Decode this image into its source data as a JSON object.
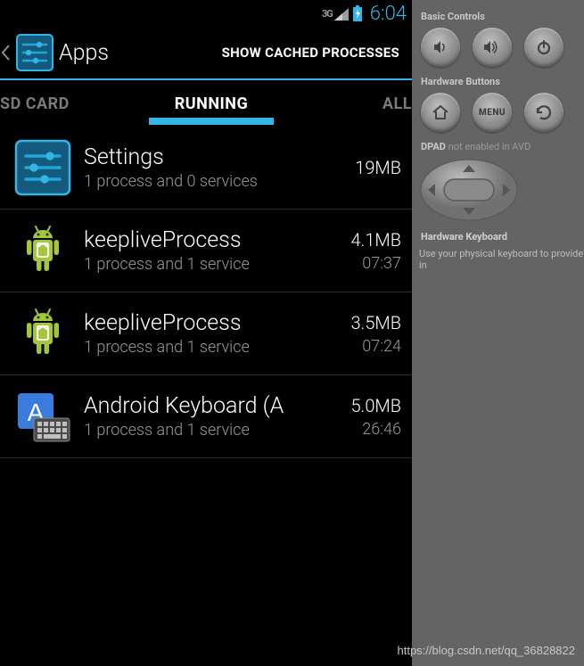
{
  "status": {
    "network": "3G",
    "time": "6:04"
  },
  "header": {
    "title": "Apps",
    "action": "SHOW CACHED PROCESSES"
  },
  "tabs": {
    "left": "SD CARD",
    "center": "RUNNING",
    "right": "ALL"
  },
  "apps": [
    {
      "icon": "settings",
      "title": "Settings",
      "subtitle": "1 process and 0 services",
      "size": "19MB",
      "time": ""
    },
    {
      "icon": "android",
      "title": "keepliveProcess",
      "subtitle": "1 process and 1 service",
      "size": "4.1MB",
      "time": "07:37"
    },
    {
      "icon": "android",
      "title": "keepliveProcess",
      "subtitle": "1 process and 1 service",
      "size": "3.5MB",
      "time": "07:24"
    },
    {
      "icon": "keyboard",
      "title": "Android Keyboard (A",
      "subtitle": "1 process and 1 service",
      "size": "5.0MB",
      "time": "26:46"
    }
  ],
  "emulator": {
    "basic_controls": "Basic Controls",
    "hardware_buttons": "Hardware Buttons",
    "menu": "MENU",
    "dpad": "DPAD",
    "dpad_note": "not enabled in AVD",
    "hw_keyboard": "Hardware Keyboard",
    "hw_keyboard_note": "Use your physical keyboard to provide in"
  },
  "watermark": "https://blog.csdn.net/qq_36828822"
}
